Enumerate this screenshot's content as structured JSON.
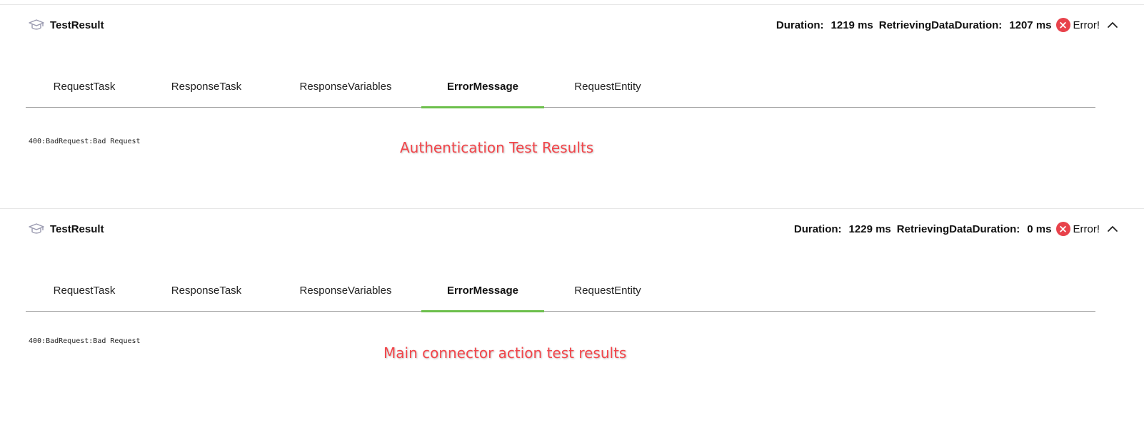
{
  "panels": [
    {
      "title": "TestResult",
      "duration_label": "Duration:",
      "duration_value": "1219 ms",
      "retrieving_label": "RetrievingDataDuration:",
      "retrieving_value": "1207 ms",
      "status_text": "Error!",
      "tabs": [
        "RequestTask",
        "ResponseTask",
        "ResponseVariables",
        "ErrorMessage",
        "RequestEntity"
      ],
      "active_tab": "ErrorMessage",
      "error_message": "400:BadRequest:Bad Request",
      "annotation": "Authentication Test Results"
    },
    {
      "title": "TestResult",
      "duration_label": "Duration:",
      "duration_value": "1229 ms",
      "retrieving_label": "RetrievingDataDuration:",
      "retrieving_value": "0 ms",
      "status_text": "Error!",
      "tabs": [
        "RequestTask",
        "ResponseTask",
        "ResponseVariables",
        "ErrorMessage",
        "RequestEntity"
      ],
      "active_tab": "ErrorMessage",
      "error_message": "400:BadRequest:Bad Request",
      "annotation": "Main connector action test results"
    }
  ],
  "icons": {
    "title_icon": "graduation-cap-icon",
    "status_icon": "error-x-icon",
    "collapse_icon": "chevron-up-icon"
  },
  "colors": {
    "active_tab_underline": "#6cbf4b",
    "error_badge": "#e8424b",
    "annotation_text": "#f2454a",
    "divider": "#9e9e9e"
  }
}
